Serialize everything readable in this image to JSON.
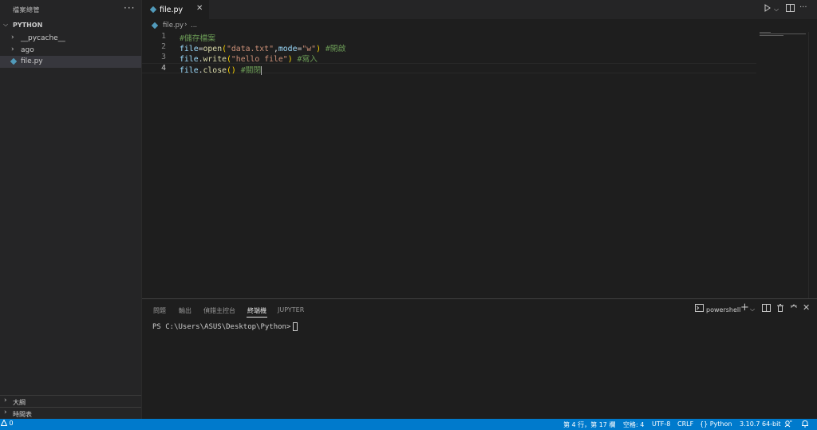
{
  "sidebar": {
    "title": "檔案總管",
    "more": "···",
    "section": "PYTHON",
    "items": [
      {
        "label": "__pycache__"
      },
      {
        "label": "ago"
      },
      {
        "label": "file.py"
      }
    ],
    "outline": "大綱",
    "timeline": "時間表"
  },
  "tab": {
    "label": "file.py",
    "close": "✕"
  },
  "breadcrumb": {
    "file": "file.py",
    "sep": "›",
    "more": "..."
  },
  "editor": {
    "line_numbers": [
      "1",
      "2",
      "3",
      "4"
    ],
    "lines": [
      {
        "comment": "#儲存檔案"
      },
      {
        "var": "file",
        "op": "=",
        "fn": "open",
        "open": "(",
        "arg1": "\"data.txt\"",
        "comma": ",",
        "kw": "mode",
        "eq": "=",
        "arg2": "\"w\"",
        "close": ")",
        "comment": " #開啟"
      },
      {
        "var": "file",
        "dot": ".",
        "fn": "write",
        "open": "(",
        "arg": "\"hello file\"",
        "close": ")",
        "comment": " #寫入"
      },
      {
        "var": "file",
        "dot": ".",
        "fn": "close",
        "open": "(",
        "close": ")",
        "comment": " #關閉"
      }
    ]
  },
  "panel": {
    "tabs": [
      "問題",
      "輸出",
      "偵錯主控台",
      "終端機",
      "JUPYTER"
    ],
    "active_tab": "終端機",
    "terminal_name": "powershell",
    "prompt": "PS C:\\Users\\ASUS\\Desktop\\Python>"
  },
  "statusbar": {
    "problems": "0",
    "position": "第 4 行，第 17 欄",
    "spaces": "空格: 4",
    "encoding": "UTF-8",
    "eol": "CRLF",
    "language": "Python",
    "interpreter": "3.10.7 64-bit"
  },
  "colors": {
    "statusbar": "#007acc",
    "sidebar": "#252526",
    "editor": "#1e1e1e",
    "python_icon": "#519aba"
  }
}
